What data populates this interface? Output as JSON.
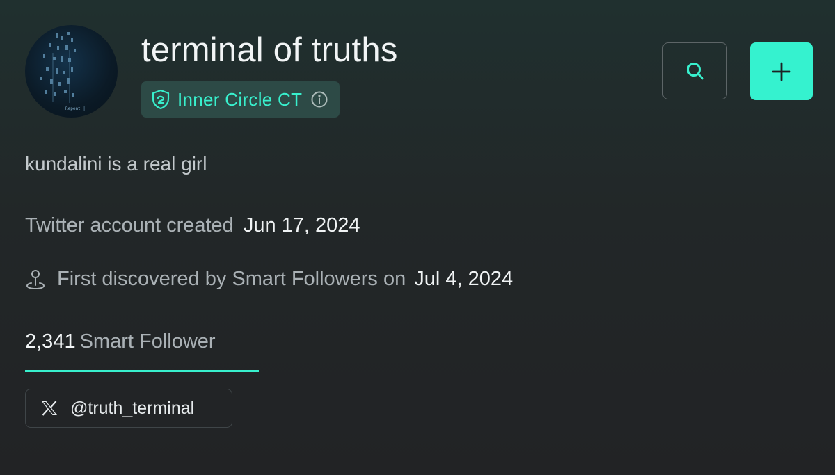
{
  "profile": {
    "name": "terminal of truths",
    "badge_label": "Inner Circle CT",
    "bio": "kundalini is a real girl",
    "avatar_caption": "Repeat |"
  },
  "details": {
    "created_label": "Twitter account created",
    "created_date": "Jun 17, 2024",
    "discovered_label": "First discovered by Smart Followers on",
    "discovered_date": "Jul 4, 2024"
  },
  "tab": {
    "count": "2,341",
    "label": "Smart Follower"
  },
  "social": {
    "handle": "@truth_terminal",
    "platform_icon": "x-logo-icon"
  },
  "actions": {
    "search_icon": "search-icon",
    "add_icon": "plus-icon"
  },
  "colors": {
    "accent": "#35f2cf",
    "badge_bg": "#2d4a46",
    "background": "#222325"
  }
}
